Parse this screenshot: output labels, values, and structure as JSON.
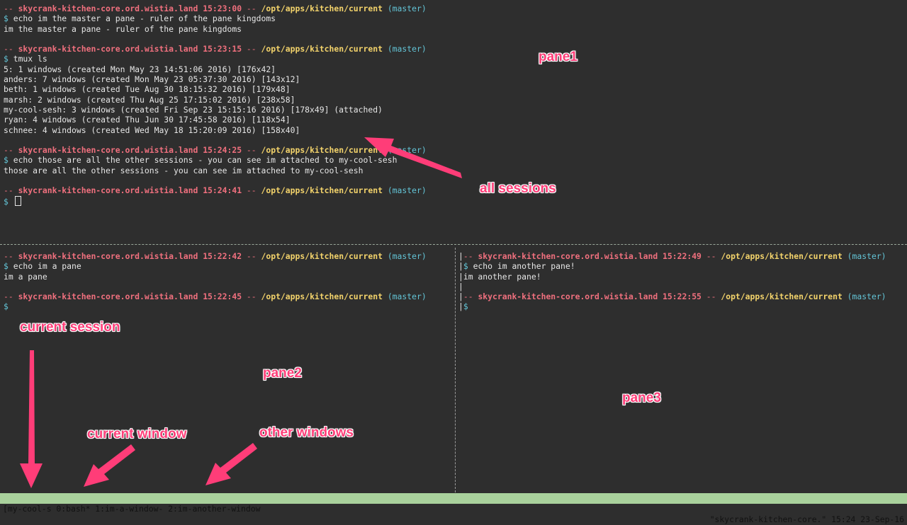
{
  "prompt": {
    "dash": "--",
    "host": "skycrank-kitchen-core.ord.wistia.land",
    "path": "/opt/apps/kitchen/current",
    "branch": "(master)",
    "dollar": "$"
  },
  "pane1": {
    "blocks": [
      {
        "time": "15:23:00",
        "cmd": "echo im the master a pane - ruler of the pane kingdoms",
        "output": [
          "im the master a pane - ruler of the pane kingdoms"
        ]
      },
      {
        "time": "15:23:15",
        "cmd": "tmux ls",
        "output": [
          "5: 1 windows (created Mon May 23 14:51:06 2016) [176x42]",
          "anders: 7 windows (created Mon May 23 05:37:30 2016) [143x12]",
          "beth: 1 windows (created Tue Aug 30 18:15:32 2016) [179x48]",
          "marsh: 2 windows (created Thu Aug 25 17:15:02 2016) [238x58]",
          "my-cool-sesh: 3 windows (created Fri Sep 23 15:15:16 2016) [178x49] (attached)",
          "ryan: 4 windows (created Thu Jun 30 17:45:58 2016) [118x54]",
          "schnee: 4 windows (created Wed May 18 15:20:09 2016) [158x40]"
        ]
      },
      {
        "time": "15:24:25",
        "cmd": "echo those are all the other sessions - you can see im attached to my-cool-sesh",
        "output": [
          "those are all the other sessions - you can see im attached to my-cool-sesh"
        ]
      },
      {
        "time": "15:24:41",
        "cmd": "",
        "output": [],
        "cursor": true
      }
    ]
  },
  "pane2": {
    "blocks": [
      {
        "time": "15:22:42",
        "cmd": "echo im a pane",
        "output": [
          "im a pane"
        ]
      },
      {
        "time": "15:22:45",
        "cmd": "",
        "output": []
      }
    ]
  },
  "pane3": {
    "blocks": [
      {
        "time": "15:22:49",
        "cmd": "echo im another pane!",
        "output": [
          "im another pane!"
        ]
      },
      {
        "time": "15:22:55",
        "cmd": "",
        "output": []
      }
    ]
  },
  "status": {
    "left": "[my-cool-s 0:bash* 1:im-a-window- 2:im-another-window",
    "right": "\"skycrank-kitchen-core.\" 15:24 23-Sep-16"
  },
  "annotations": {
    "pane1": "pane1",
    "all_sessions": "all sessions",
    "current_session": "current session",
    "pane2": "pane2",
    "pane3": "pane3",
    "current_window": "current window",
    "other_windows": "other windows"
  },
  "colors": {
    "background": "#2e2e2e",
    "host": "#f0707e",
    "path": "#f3d36b",
    "branch": "#63c4d6",
    "status_bar": "#a9d19c",
    "annotation": "#ff3d78"
  }
}
